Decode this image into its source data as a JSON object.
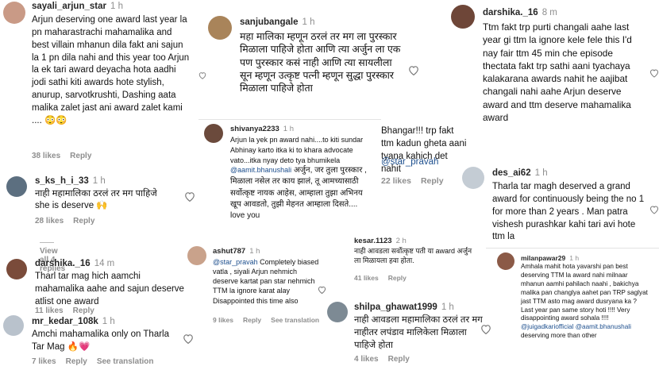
{
  "colors": {
    "link": "#1c4e8d",
    "meta": "#8e8e8e",
    "heart_red": "#e0245e"
  },
  "c1": {
    "user": "sayali_arjun_star",
    "time": "1 h",
    "text": "Arjun deserving one award last year la pn maharastrachi mahamalika and best villain mhanun dila fakt ani sajun la 1 pn dila nahi and this year too Arjun la ek tari award deyacha hota aadhi jodi sathi kiti awards hote stylish, anurup, sarvotkrushti, Dashing aata malika zalet jast ani award zalet kami .... 😳😳",
    "likes": "38 likes",
    "reply": "Reply"
  },
  "c2": {
    "user": "s_ks_h_i_33",
    "time": "1 h",
    "text1": "नाही महामालिका ठरलं तर मग पाहिजे",
    "text2": "she is deserve 🙌",
    "likes": "28 likes",
    "reply": "Reply",
    "view_all": "View all 4 replies"
  },
  "c3": {
    "user": "darshika._16",
    "time": "14 m",
    "text": "Tharl tar mag hich aamchi mahamalika aahe and sajun deserve atlist one award",
    "likes": "11 likes",
    "reply": "Reply"
  },
  "c4": {
    "user": "mr_kedar_108k",
    "time": "1 h",
    "text": "Amchi mahamalika only on Tharla Tar Mag 🔥💗",
    "likes": "7 likes",
    "reply": "Reply",
    "see_translation": "See translation"
  },
  "c5": {
    "user": "sanjubangale",
    "time": "1 h",
    "text": "महा मालिका म्हणून ठरलं तर मग ला पुरस्कार मिळाला पाहिजे होता आणि त्या अर्जुन ला एक पण पुरस्कार कसं नाही आणि त्या सायलीला सून म्हणून उत्कृष्ट पत्नी म्हणून सुद्धा पुरस्कार मिळाला पाहिजे होता"
  },
  "c6": {
    "user": "shivanya2233",
    "time": "1 h",
    "text_a": "Arjun la yek pn award nahi....to kiti sundar Abhinay karto itka ki to khara advocate vato...itka nyay deto tya bhumikela ",
    "mention": "@aamit.bhanushali",
    "text_b": " अर्जुन, जर तुला पुरस्कार , मिळाला नसेल तर काय झालं, तू आमच्यासाठी सर्वोत्कृष्ट नायक आहेस, आम्हाला तुझा अभिनय खूप आवडतो, तुझी मेहनत आम्हाला दिसते.... love you"
  },
  "c7": {
    "user": "ashut787",
    "time": "1 h",
    "mention": "@star_pravah",
    "text": " Completely biased vatla , siyali Arjun nehmich deserve kartat pan star nehmich TTM la ignore karat alay Disappointed this time also",
    "likes": "9 likes",
    "reply": "Reply",
    "see_translation": "See translation"
  },
  "c8": {
    "text": "Bhangar!!! trp fakt ttm kadun gheta aani tyana kahich det nahit",
    "mention": "@star_pravah",
    "likes": "22 likes",
    "reply": "Reply"
  },
  "c9": {
    "user": "kesar.1123",
    "time": "2 h",
    "text": "नाही आवडला सर्वोत्कृष्ट पती या award अर्जुन ला मिळायला हवा होता.",
    "likes": "41 likes",
    "reply": "Reply"
  },
  "c10": {
    "user": "shilpa_ghawat1999",
    "time": "1 h",
    "text": "नाही आवडला महामालिका ठरलं तर मग नाहीतर लपंडाव मालिकेला मिळाला पाहिजे होता",
    "likes": "4 likes",
    "reply": "Reply"
  },
  "c11": {
    "user": "darshika._16",
    "time": "8 m",
    "text": "Ttm fakt trp purti changali aahe last year gi ttm la ignore kele fele this I'd nay fair ttm 45 min che episode thectata fakt trp sathi aani tyachaya kalakarana awards nahit he aajibat changali nahi aahe Arjun deserve award and ttm deserve mahamalika award"
  },
  "c12": {
    "user": "des_ai62",
    "time": "1 h",
    "text": "Tharla tar magh deserved a grand award for continuously being the no 1 for more than 2 years . Man patra vishesh purashkar kahi tari avi hote ttm la"
  },
  "c13": {
    "user": "milanpawar29",
    "time": "1 h",
    "text_a": "Amhala mahit hota yavarshi pan best deserving TTM la award nahi milnaar mhanun aamhi pahilach naahi , bakichya malika pan changlya aahet pan TRP saglyat jast TTM asto mag award dusryana ka ? Last year pan same story hoti !!!! Very disappointing award sohala !!!! ",
    "mention1": "@juigadkariofficial",
    "mention2": "@aamit.bhanushali",
    "text_b": " deserving more than other"
  }
}
